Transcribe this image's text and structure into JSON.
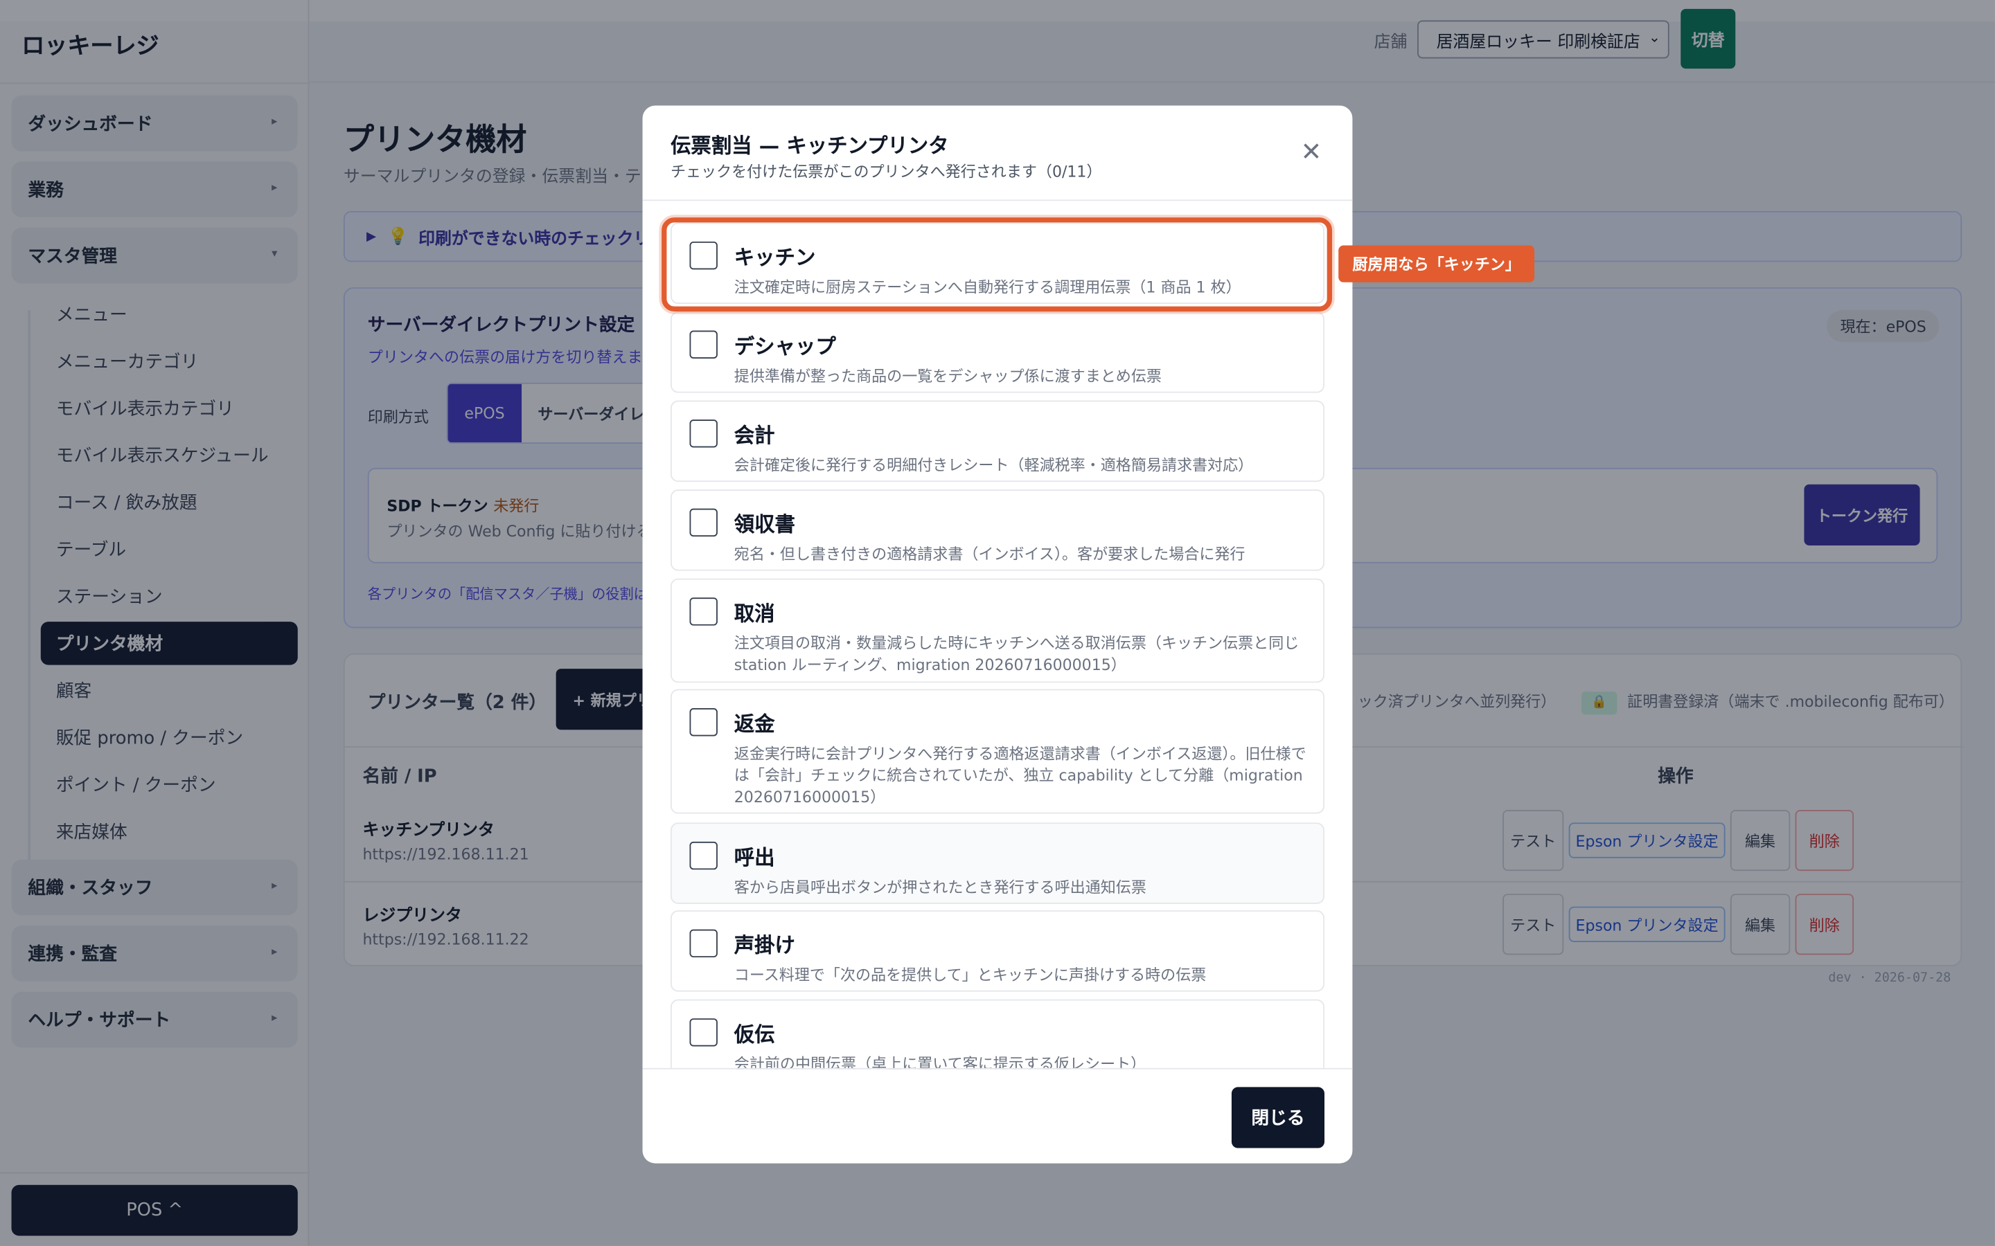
{
  "app": {
    "brand": "ロッキーレジ"
  },
  "header": {
    "store_label": "店舗",
    "store_value": "居酒屋ロッキー 印刷検証店",
    "switch_label": "切替"
  },
  "sidebar": {
    "groups": [
      {
        "label": "ダッシュボード"
      },
      {
        "label": "業務"
      },
      {
        "label": "マスタ管理"
      },
      {
        "label": "組織・スタッフ"
      },
      {
        "label": "連携・監査"
      },
      {
        "label": "ヘルプ・サポート"
      }
    ],
    "items": [
      "メニュー",
      "メニューカテゴリ",
      "モバイル表示カテゴリ",
      "モバイル表示スケジュール",
      "コース / 飲み放題",
      "テーブル",
      "ステーション",
      "プリンタ機材",
      "顧客",
      "販促 promo / クーポン",
      "ポイント / クーポン",
      "来店媒体"
    ],
    "pos_label": "POS ^"
  },
  "page": {
    "title": "プリンタ機材",
    "subtitle": "サーマルプリンタの登録・伝票割当・テス",
    "help_label": "印刷ができない時のチェックリ",
    "server_direct": {
      "title": "サーバーダイレクトプリント設定",
      "desc": "プリンタへの伝票の届け方を切り替えます。",
      "current": "現在：ePOS",
      "mode_label": "印刷方式",
      "mode_epos": "ePOS",
      "mode_sd": "サーバーダイレクト",
      "sdp_title": "SDP トークン",
      "sdp_status": "未発行",
      "sdp_desc": "プリンタの Web Config に貼り付ける U",
      "token_button": "トークン発行",
      "note": "各プリンタの「配信マスタ／子機」の役割は、下"
    },
    "printer_list": {
      "title": "プリンター覧（2 件）",
      "new_button": "+ 新規プリ",
      "note_text": "ック済プリンタへ並列発行）",
      "cert_text": "証明書登録済（端末で .mobileconfig 配布可）",
      "col_name": "名前 / IP",
      "col_ops": "操作",
      "rows": [
        {
          "name": "キッチンプリンタ",
          "ip": "https://192.168.11.21"
        },
        {
          "name": "レジプリンタ",
          "ip": "https://192.168.11.22"
        }
      ],
      "ops": {
        "test": "テスト",
        "epson": "Epson プリンタ設定",
        "edit": "編集",
        "delete": "削除"
      }
    },
    "dev_footer": "dev · 2026-07-28"
  },
  "modal": {
    "title": "伝票割当 — キッチンプリンタ",
    "subtitle": "チェックを付けた伝票がこのプリンタへ発行されます（0/11）",
    "options": [
      {
        "name": "キッチン",
        "desc": "注文確定時に厨房ステーションへ自動発行する調理用伝票（1 商品 1 枚）",
        "checked": false
      },
      {
        "name": "デシャップ",
        "desc": "提供準備が整った商品の一覧をデシャップ係に渡すまとめ伝票",
        "checked": false
      },
      {
        "name": "会計",
        "desc": "会計確定後に発行する明細付きレシート（軽減税率・適格簡易請求書対応）",
        "checked": false
      },
      {
        "name": "領収書",
        "desc": "宛名・但し書き付きの適格請求書（インボイス）。客が要求した場合に発行",
        "checked": false
      },
      {
        "name": "取消",
        "desc": "注文項目の取消・数量減らした時にキッチンへ送る取消伝票（キッチン伝票と同じ station ルーティング、migration 20260716000015）",
        "checked": false
      },
      {
        "name": "返金",
        "desc": "返金実行時に会計プリンタへ発行する適格返還請求書（インボイス返還）。旧仕様では「会計」チェックに統合されていたが、独立 capability として分離（migration 20260716000015）",
        "checked": false
      },
      {
        "name": "呼出",
        "desc": "客から店員呼出ボタンが押されたとき発行する呼出通知伝票",
        "checked": false
      },
      {
        "name": "声掛け",
        "desc": "コース料理で「次の品を提供して」とキッチンに声掛けする時の伝票",
        "checked": false
      },
      {
        "name": "仮伝",
        "desc": "会計前の中間伝票（卓上に置いて客に提示する仮レシート）",
        "checked": false
      }
    ],
    "highlight_tag": "厨房用なら「キッチン」",
    "close_button": "閉じる"
  }
}
